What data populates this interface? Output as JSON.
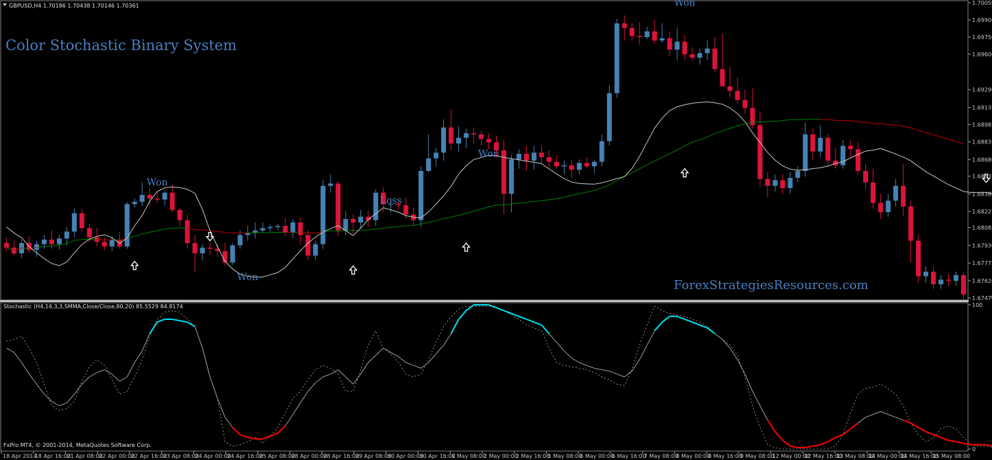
{
  "header": {
    "symbol_info": "GBPUSD,H4  1.70186 1.70438 1.70146 1.70361",
    "stoch_info": "Stochastic (H4,14,3,3,SMMA,Close/Close,80,20) 85.5529 84.8174",
    "footer": "FxPro MT4, © 2001-2014, MetaQuotes Software Corp."
  },
  "title": "Color Stochastic  Binary System",
  "watermark": "ForexStrategiesResources.com",
  "colors": {
    "bull": "#4682b4",
    "bear": "#dc143c",
    "ma_up": "#008000",
    "ma_down": "#c00000",
    "band": "#c8c8c8",
    "stoch_main": "#a0a0a0",
    "stoch_overbought": "#00e0f0",
    "stoch_oversold": "#ff0000",
    "annotation": "#4a7fc0"
  },
  "chart_data": [
    {
      "type": "candlestick",
      "y_axis_ticks": [
        "1.70050",
        "1.69900",
        "1.69750",
        "1.69600",
        "1.69290",
        "1.69135",
        "1.68985",
        "1.68835",
        "1.68680",
        "1.68535",
        "1.68380",
        "1.68225",
        "1.68085",
        "1.67930",
        "1.67775",
        "1.67620",
        "1.67470"
      ],
      "ylim": [
        1.6747,
        1.7005
      ],
      "x_axis_ticks": [
        "18 Apr 2014",
        "18 Apr 16:00",
        "21 Apr 08:00",
        "22 Apr 00:00",
        "22 Apr 16:00",
        "23 Apr 08:00",
        "24 Apr 00:00",
        "24 Apr 16:00",
        "25 Apr 08:00",
        "28 Apr 00:00",
        "28 Apr 16:00",
        "29 Apr 08:00",
        "30 Apr 00:00",
        "30 Apr 16:00",
        "1 May 08:00",
        "2 May 00:00",
        "2 May 16:00",
        "5 May 08:00",
        "6 May 00:00",
        "6 May 16:00",
        "7 May 08:00",
        "8 May 00:00",
        "8 May 16:00",
        "9 May 08:00",
        "12 May 00:00",
        "12 May 16:00",
        "13 May 08:00",
        "14 May 00:00",
        "14 May 16:00",
        "15 May 08:00"
      ],
      "ohlc": [
        [
          1.6795,
          1.68,
          1.6788,
          1.6791
        ],
        [
          1.6791,
          1.6797,
          1.6784,
          1.6786
        ],
        [
          1.6786,
          1.6798,
          1.6782,
          1.6795
        ],
        [
          1.6795,
          1.6801,
          1.6786,
          1.6789
        ],
        [
          1.6789,
          1.6797,
          1.6783,
          1.6794
        ],
        [
          1.6794,
          1.6802,
          1.679,
          1.6798
        ],
        [
          1.6798,
          1.6806,
          1.679,
          1.6794
        ],
        [
          1.6794,
          1.6802,
          1.6789,
          1.6799
        ],
        [
          1.6799,
          1.6809,
          1.6793,
          1.6805
        ],
        [
          1.6805,
          1.6825,
          1.68,
          1.6821
        ],
        [
          1.6821,
          1.6825,
          1.6805,
          1.6808
        ],
        [
          1.6808,
          1.6812,
          1.6796,
          1.68
        ],
        [
          1.68,
          1.6808,
          1.6792,
          1.6796
        ],
        [
          1.6796,
          1.68,
          1.6789,
          1.6792
        ],
        [
          1.6792,
          1.6801,
          1.6788,
          1.6798
        ],
        [
          1.6798,
          1.6805,
          1.679,
          1.6792
        ],
        [
          1.6792,
          1.6831,
          1.679,
          1.6829
        ],
        [
          1.6829,
          1.6834,
          1.6826,
          1.6831
        ],
        [
          1.6831,
          1.6848,
          1.6827,
          1.6837
        ],
        [
          1.6837,
          1.6843,
          1.6827,
          1.6834
        ],
        [
          1.6834,
          1.6839,
          1.683,
          1.6833
        ],
        [
          1.6833,
          1.6841,
          1.6828,
          1.6839
        ],
        [
          1.6839,
          1.6846,
          1.6822,
          1.6824
        ],
        [
          1.6824,
          1.6826,
          1.681,
          1.6815
        ],
        [
          1.6815,
          1.682,
          1.679,
          1.6795
        ],
        [
          1.6795,
          1.6802,
          1.677,
          1.6786
        ],
        [
          1.6786,
          1.6794,
          1.678,
          1.6791
        ],
        [
          1.6791,
          1.6796,
          1.6785,
          1.679
        ],
        [
          1.679,
          1.6794,
          1.6783,
          1.6788
        ],
        [
          1.6788,
          1.6795,
          1.6775,
          1.6778
        ],
        [
          1.6778,
          1.6795,
          1.6776,
          1.6793
        ],
        [
          1.6793,
          1.6806,
          1.679,
          1.6802
        ],
        [
          1.6802,
          1.681,
          1.6797,
          1.6804
        ],
        [
          1.6804,
          1.6813,
          1.6799,
          1.6806
        ],
        [
          1.6806,
          1.6813,
          1.6804,
          1.6808
        ],
        [
          1.6808,
          1.6811,
          1.6804,
          1.6809
        ],
        [
          1.6809,
          1.6812,
          1.6806,
          1.681
        ],
        [
          1.681,
          1.6817,
          1.6801,
          1.6804
        ],
        [
          1.6804,
          1.6816,
          1.6799,
          1.6813
        ],
        [
          1.6813,
          1.6817,
          1.6794,
          1.6802
        ],
        [
          1.6802,
          1.6806,
          1.678,
          1.6784
        ],
        [
          1.6784,
          1.6797,
          1.678,
          1.6794
        ],
        [
          1.6794,
          1.685,
          1.679,
          1.6845
        ],
        [
          1.6845,
          1.6855,
          1.6839,
          1.6847
        ],
        [
          1.6847,
          1.6849,
          1.6801,
          1.6806
        ],
        [
          1.6806,
          1.6823,
          1.6802,
          1.6816
        ],
        [
          1.6816,
          1.682,
          1.6803,
          1.6813
        ],
        [
          1.6813,
          1.6824,
          1.6808,
          1.6818
        ],
        [
          1.6818,
          1.6823,
          1.6809,
          1.6815
        ],
        [
          1.6815,
          1.6842,
          1.681,
          1.6839
        ],
        [
          1.6839,
          1.6844,
          1.6822,
          1.6829
        ],
        [
          1.6829,
          1.6834,
          1.6822,
          1.6829
        ],
        [
          1.6829,
          1.6831,
          1.6824,
          1.6828
        ],
        [
          1.6828,
          1.6835,
          1.6816,
          1.682
        ],
        [
          1.682,
          1.6826,
          1.681,
          1.6815
        ],
        [
          1.6815,
          1.6862,
          1.6809,
          1.6858
        ],
        [
          1.6858,
          1.689,
          1.6857,
          1.6869
        ],
        [
          1.6869,
          1.6878,
          1.6862,
          1.6874
        ],
        [
          1.6874,
          1.6903,
          1.6867,
          1.6896
        ],
        [
          1.6896,
          1.6912,
          1.6876,
          1.6882
        ],
        [
          1.6882,
          1.6897,
          1.6875,
          1.6887
        ],
        [
          1.6887,
          1.6895,
          1.6878,
          1.6891
        ],
        [
          1.6891,
          1.6896,
          1.6882,
          1.689
        ],
        [
          1.689,
          1.6893,
          1.688,
          1.6886
        ],
        [
          1.6886,
          1.6891,
          1.6877,
          1.6883
        ],
        [
          1.6883,
          1.6889,
          1.687,
          1.6876
        ],
        [
          1.6876,
          1.6885,
          1.682,
          1.6838
        ],
        [
          1.6838,
          1.6872,
          1.6822,
          1.6868
        ],
        [
          1.6868,
          1.6877,
          1.686,
          1.6873
        ],
        [
          1.6873,
          1.688,
          1.6858,
          1.6867
        ],
        [
          1.6867,
          1.688,
          1.6859,
          1.6874
        ],
        [
          1.6874,
          1.688,
          1.6864,
          1.687
        ],
        [
          1.687,
          1.6876,
          1.686,
          1.6866
        ],
        [
          1.6866,
          1.6871,
          1.686,
          1.6862
        ],
        [
          1.6862,
          1.6867,
          1.6855,
          1.6863
        ],
        [
          1.6863,
          1.6868,
          1.6852,
          1.6859
        ],
        [
          1.6859,
          1.6868,
          1.6855,
          1.6865
        ],
        [
          1.6865,
          1.687,
          1.686,
          1.6862
        ],
        [
          1.6862,
          1.6868,
          1.6856,
          1.6866
        ],
        [
          1.6866,
          1.689,
          1.6862,
          1.6884
        ],
        [
          1.6884,
          1.6933,
          1.688,
          1.6926
        ],
        [
          1.6926,
          1.6991,
          1.6922,
          1.6987
        ],
        [
          1.6987,
          1.6994,
          1.6972,
          1.6983
        ],
        [
          1.6983,
          1.6987,
          1.6972,
          1.6976
        ],
        [
          1.6976,
          1.6988,
          1.6968,
          1.6975
        ],
        [
          1.6975,
          1.6984,
          1.6973,
          1.698
        ],
        [
          1.698,
          1.699,
          1.6969,
          1.6972
        ],
        [
          1.6972,
          1.6987,
          1.697,
          1.6974
        ],
        [
          1.6974,
          1.698,
          1.6958,
          1.6964
        ],
        [
          1.6964,
          1.6983,
          1.6955,
          1.6971
        ],
        [
          1.6971,
          1.6977,
          1.6955,
          1.696
        ],
        [
          1.696,
          1.6966,
          1.6954,
          1.6957
        ],
        [
          1.6957,
          1.6965,
          1.6951,
          1.6961
        ],
        [
          1.6961,
          1.6972,
          1.6955,
          1.6965
        ],
        [
          1.6965,
          1.6975,
          1.6944,
          1.6947
        ],
        [
          1.6947,
          1.6978,
          1.6941,
          1.6932
        ],
        [
          1.6932,
          1.6949,
          1.6922,
          1.6928
        ],
        [
          1.6928,
          1.694,
          1.6917,
          1.692
        ],
        [
          1.692,
          1.6929,
          1.6908,
          1.6913
        ],
        [
          1.6913,
          1.693,
          1.6895,
          1.6898
        ],
        [
          1.6898,
          1.691,
          1.6844,
          1.6851
        ],
        [
          1.6851,
          1.6857,
          1.6835,
          1.6845
        ],
        [
          1.6845,
          1.6855,
          1.684,
          1.685
        ],
        [
          1.685,
          1.6855,
          1.6838,
          1.6843
        ],
        [
          1.6843,
          1.6857,
          1.6838,
          1.6852
        ],
        [
          1.6852,
          1.6862,
          1.6848,
          1.6858
        ],
        [
          1.6858,
          1.69,
          1.6853,
          1.689
        ],
        [
          1.689,
          1.6895,
          1.6868,
          1.6875
        ],
        [
          1.6875,
          1.6898,
          1.687,
          1.6887
        ],
        [
          1.6887,
          1.689,
          1.6862,
          1.6867
        ],
        [
          1.6867,
          1.6878,
          1.686,
          1.6863
        ],
        [
          1.6863,
          1.6885,
          1.686,
          1.688
        ],
        [
          1.688,
          1.6885,
          1.687,
          1.6877
        ],
        [
          1.6877,
          1.6883,
          1.6855,
          1.6858
        ],
        [
          1.6858,
          1.6864,
          1.6842,
          1.6848
        ],
        [
          1.6848,
          1.686,
          1.6825,
          1.683
        ],
        [
          1.683,
          1.6838,
          1.6816,
          1.6822
        ],
        [
          1.6822,
          1.6838,
          1.6818,
          1.6832
        ],
        [
          1.6832,
          1.6851,
          1.6827,
          1.6845
        ],
        [
          1.6845,
          1.6864,
          1.6819,
          1.6827
        ],
        [
          1.6827,
          1.6832,
          1.6778,
          1.6797
        ],
        [
          1.6797,
          1.6803,
          1.676,
          1.6766
        ],
        [
          1.6766,
          1.6775,
          1.676,
          1.677
        ],
        [
          1.677,
          1.6774,
          1.6755,
          1.6759
        ],
        [
          1.6759,
          1.6767,
          1.6755,
          1.6763
        ],
        [
          1.6763,
          1.6768,
          1.6757,
          1.6762
        ],
        [
          1.6762,
          1.677,
          1.6758,
          1.6767
        ],
        [
          1.6767,
          1.677,
          1.6745,
          1.675
        ]
      ],
      "annotations": [
        {
          "text": "Won",
          "bar": 20,
          "price": 1.6843,
          "pos": "above"
        },
        {
          "text": "Won",
          "bar": 32,
          "price": 1.6771,
          "pos": "below"
        },
        {
          "text": "Loss",
          "bar": 51,
          "price": 1.6827,
          "pos": "above"
        },
        {
          "text": "Won",
          "bar": 64,
          "price": 1.6868,
          "pos": "above"
        },
        {
          "text": "Won",
          "bar": 90,
          "price": 1.7,
          "pos": "above"
        },
        {
          "text": "Won",
          "bar": 132,
          "price": 1.6751,
          "pos": "below"
        }
      ],
      "signals": [
        {
          "dir": "up",
          "bar": 17,
          "price": 1.6779
        },
        {
          "dir": "down",
          "bar": 27,
          "price": 1.6797
        },
        {
          "dir": "up",
          "bar": 46,
          "price": 1.6775
        },
        {
          "dir": "up",
          "bar": 61,
          "price": 1.6795
        },
        {
          "dir": "up",
          "bar": 90,
          "price": 1.686
        },
        {
          "dir": "down",
          "bar": 130,
          "price": 1.6848
        }
      ]
    },
    {
      "type": "line",
      "ylim": [
        0,
        100
      ],
      "y_axis_ticks": [
        "100",
        "0"
      ],
      "series": [
        {
          "values": [
            70,
            67,
            60,
            52,
            45,
            38,
            33,
            30,
            32,
            38,
            45,
            50,
            53,
            55,
            52,
            47,
            50,
            60,
            68,
            80,
            88,
            90,
            90,
            89,
            88,
            85,
            70,
            50,
            35,
            22,
            15,
            10,
            8,
            7,
            7,
            9,
            11,
            16,
            24,
            32,
            40,
            46,
            50,
            52,
            55,
            50,
            45,
            52,
            60,
            65,
            70,
            67,
            64,
            60,
            58,
            56,
            60,
            66,
            72,
            80,
            90,
            96,
            100,
            100,
            100,
            98,
            96,
            94,
            92,
            90,
            88,
            86,
            80,
            74,
            68,
            63,
            60,
            58,
            56,
            55,
            54,
            52,
            50,
            54,
            62,
            72,
            82,
            88,
            92,
            92,
            90,
            88,
            86,
            84,
            80,
            76,
            70,
            62,
            52,
            40,
            30,
            20,
            12,
            6,
            2,
            1,
            1,
            2,
            3,
            5,
            8,
            10,
            14,
            18,
            22,
            24,
            26,
            24,
            22,
            20,
            18,
            15,
            12,
            10,
            8,
            6,
            5,
            4,
            3,
            3,
            3,
            2,
            2
          ]
        },
        {
          "values": [
            75,
            76,
            78,
            70,
            60,
            45,
            30,
            27,
            28,
            33,
            47,
            57,
            62,
            58,
            48,
            38,
            40,
            50,
            62,
            78,
            90,
            95,
            96,
            95,
            90,
            85,
            70,
            50,
            35,
            5,
            2,
            3,
            5,
            8,
            4,
            9,
            15,
            25,
            35,
            40,
            48,
            55,
            58,
            56,
            52,
            40,
            40,
            55,
            72,
            82,
            70,
            66,
            60,
            52,
            50,
            52,
            62,
            74,
            85,
            92,
            97,
            99,
            99,
            99,
            99,
            98,
            96,
            93,
            90,
            86,
            84,
            82,
            70,
            60,
            58,
            57,
            56,
            55,
            53,
            50,
            48,
            45,
            44,
            55,
            72,
            86,
            99,
            96,
            94,
            93,
            92,
            90,
            88,
            85,
            80,
            76,
            72,
            65,
            50,
            30,
            15,
            3,
            1,
            0,
            0,
            0,
            0,
            0,
            0,
            0,
            2,
            10,
            25,
            38,
            42,
            43,
            45,
            42,
            38,
            30,
            18,
            10,
            5,
            8,
            14,
            16,
            14,
            8,
            3,
            2,
            2,
            1,
            1
          ],
          "name": ""
        }
      ],
      "overbought": 80,
      "oversold": 20
    }
  ]
}
